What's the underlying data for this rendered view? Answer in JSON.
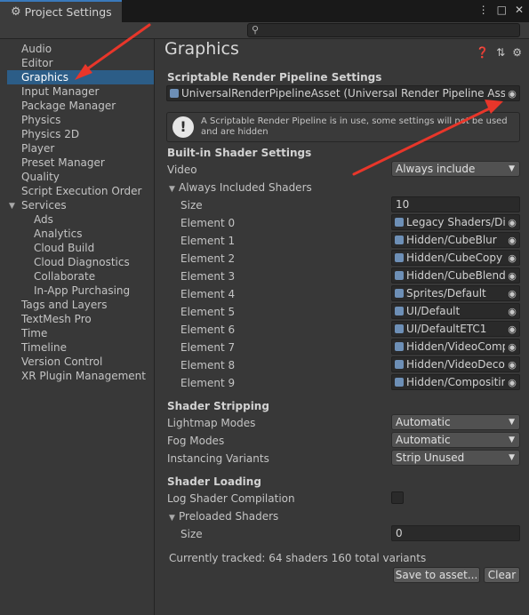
{
  "window": {
    "tab_title": "Project Settings",
    "controls": [
      "⋮",
      "□",
      "✕"
    ]
  },
  "search": {
    "value": ""
  },
  "sidebar": {
    "items": [
      {
        "label": "Audio"
      },
      {
        "label": "Editor"
      },
      {
        "label": "Graphics"
      },
      {
        "label": "Input Manager"
      },
      {
        "label": "Package Manager"
      },
      {
        "label": "Physics"
      },
      {
        "label": "Physics 2D"
      },
      {
        "label": "Player"
      },
      {
        "label": "Preset Manager"
      },
      {
        "label": "Quality"
      },
      {
        "label": "Script Execution Order"
      },
      {
        "label": "Services"
      },
      {
        "label": "Ads"
      },
      {
        "label": "Analytics"
      },
      {
        "label": "Cloud Build"
      },
      {
        "label": "Cloud Diagnostics"
      },
      {
        "label": "Collaborate"
      },
      {
        "label": "In-App Purchasing"
      },
      {
        "label": "Tags and Layers"
      },
      {
        "label": "TextMesh Pro"
      },
      {
        "label": "Time"
      },
      {
        "label": "Timeline"
      },
      {
        "label": "Version Control"
      },
      {
        "label": "XR Plugin Management"
      }
    ],
    "selected": "Graphics"
  },
  "main": {
    "title": "Graphics",
    "srp": {
      "heading": "Scriptable Render Pipeline Settings",
      "asset": "UniversalRenderPipelineAsset (Universal Render Pipeline Asset)",
      "help": "A Scriptable Render Pipeline is in use, some settings will not be used and are hidden"
    },
    "builtin": {
      "heading": "Built-in Shader Settings",
      "video_label": "Video",
      "video_value": "Always include",
      "always_included_label": "Always Included Shaders",
      "size_label": "Size",
      "size_value": "10",
      "elements": [
        {
          "label": "Element 0",
          "value": "Legacy Shaders/Dif"
        },
        {
          "label": "Element 1",
          "value": "Hidden/CubeBlur"
        },
        {
          "label": "Element 2",
          "value": "Hidden/CubeCopy"
        },
        {
          "label": "Element 3",
          "value": "Hidden/CubeBlend"
        },
        {
          "label": "Element 4",
          "value": "Sprites/Default"
        },
        {
          "label": "Element 5",
          "value": "UI/Default"
        },
        {
          "label": "Element 6",
          "value": "UI/DefaultETC1"
        },
        {
          "label": "Element 7",
          "value": "Hidden/VideoCompo"
        },
        {
          "label": "Element 8",
          "value": "Hidden/VideoDecod"
        },
        {
          "label": "Element 9",
          "value": "Hidden/Compositing"
        }
      ]
    },
    "stripping": {
      "heading": "Shader Stripping",
      "lightmap_label": "Lightmap Modes",
      "lightmap_value": "Automatic",
      "fog_label": "Fog Modes",
      "fog_value": "Automatic",
      "instancing_label": "Instancing Variants",
      "instancing_value": "Strip Unused"
    },
    "loading": {
      "heading": "Shader Loading",
      "log_label": "Log Shader Compilation",
      "preloaded_label": "Preloaded Shaders",
      "size_label": "Size",
      "size_value": "0",
      "tracked": "Currently tracked: 64 shaders 160 total variants",
      "save_button": "Save to asset...",
      "clear_button": "Clear"
    }
  },
  "colors": {
    "background": "#383838",
    "selection": "#2c5d87",
    "annotation_arrow": "#e8362a"
  }
}
